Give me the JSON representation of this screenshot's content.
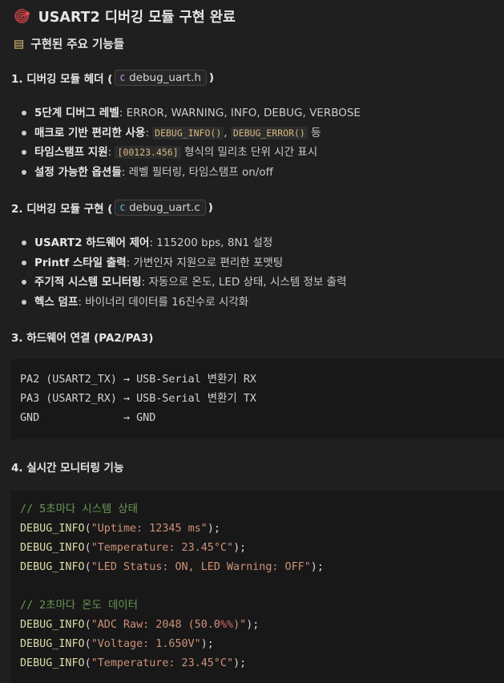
{
  "title": {
    "icon": "target-icon",
    "text": "USART2 디버깅 모듈 구현 완료"
  },
  "features_heading": {
    "icon": "memo-icon",
    "text": "구현된 주요 기능들"
  },
  "sections": [
    {
      "heading_prefix": "1. 디버깅 모듈 헤더 (",
      "file": "debug_uart.h",
      "file_icon": "c-header-icon",
      "heading_suffix": ")",
      "bullets": [
        {
          "bold": "5단계 디버그 레벨",
          "text": ": ERROR, WARNING, INFO, DEBUG, VERBOSE"
        },
        {
          "bold": "매크로 기반 편리한 사용",
          "text_before": ": ",
          "code1": "DEBUG_INFO()",
          "sep": ", ",
          "code2": "DEBUG_ERROR()",
          "text_after": " 등"
        },
        {
          "bold": "타임스탬프 지원",
          "text_before": ": ",
          "code1": "[00123.456]",
          "text_after": " 형식의 밀리초 단위 시간 표시"
        },
        {
          "bold": "설정 가능한 옵션들",
          "text": ": 레벨 필터링, 타임스탬프 on/off"
        }
      ]
    },
    {
      "heading_prefix": "2. 디버깅 모듈 구현 (",
      "file": "debug_uart.c",
      "file_icon": "c-source-icon",
      "heading_suffix": ")",
      "bullets": [
        {
          "bold": "USART2 하드웨어 제어",
          "text": ": 115200 bps, 8N1 설정"
        },
        {
          "bold": "Printf 스타일 출력",
          "text": ": 가변인자 지원으로 편리한 포맷팅"
        },
        {
          "bold": "주기적 시스템 모니터링",
          "text": ": 자동으로 온도, LED 상태, 시스템 정보 출력"
        },
        {
          "bold": "헥스 덤프",
          "text": ": 바이너리 데이터를 16진수로 시각화"
        }
      ]
    },
    {
      "heading": "3. 하드웨어 연결 (PA2/PA3)",
      "code_lines": [
        "PA2 (USART2_TX) → USB-Serial 변환기 RX",
        "PA3 (USART2_RX) → USB-Serial 변환기 TX",
        "GND             → GND"
      ]
    },
    {
      "heading": "4. 실시간 모니터링 기능",
      "code": {
        "comment1": "// 5초마다 시스템 상태",
        "group1": [
          {
            "fn": "DEBUG_INFO",
            "open": "(",
            "str": "\"Uptime: 12345 ms\"",
            "close": ");"
          },
          {
            "fn": "DEBUG_INFO",
            "open": "(",
            "str": "\"Temperature: 23.45°C\"",
            "close": ");"
          },
          {
            "fn": "DEBUG_INFO",
            "open": "(",
            "str": "\"LED Status: ON, LED Warning: OFF\"",
            "close": ");"
          }
        ],
        "comment2": "// 2초마다 온도 데이터",
        "group2": [
          {
            "fn": "DEBUG_INFO",
            "open": "(",
            "str_a": "\"ADC Raw: 2048 (50.0",
            "str_esc": "%%",
            "str_b": ")\"",
            "close": ");"
          },
          {
            "fn": "DEBUG_INFO",
            "open": "(",
            "str": "\"Voltage: 1.650V\"",
            "close": ");"
          },
          {
            "fn": "DEBUG_INFO",
            "open": "(",
            "str": "\"Temperature: 23.45°C\"",
            "close": ");"
          }
        ]
      }
    }
  ]
}
